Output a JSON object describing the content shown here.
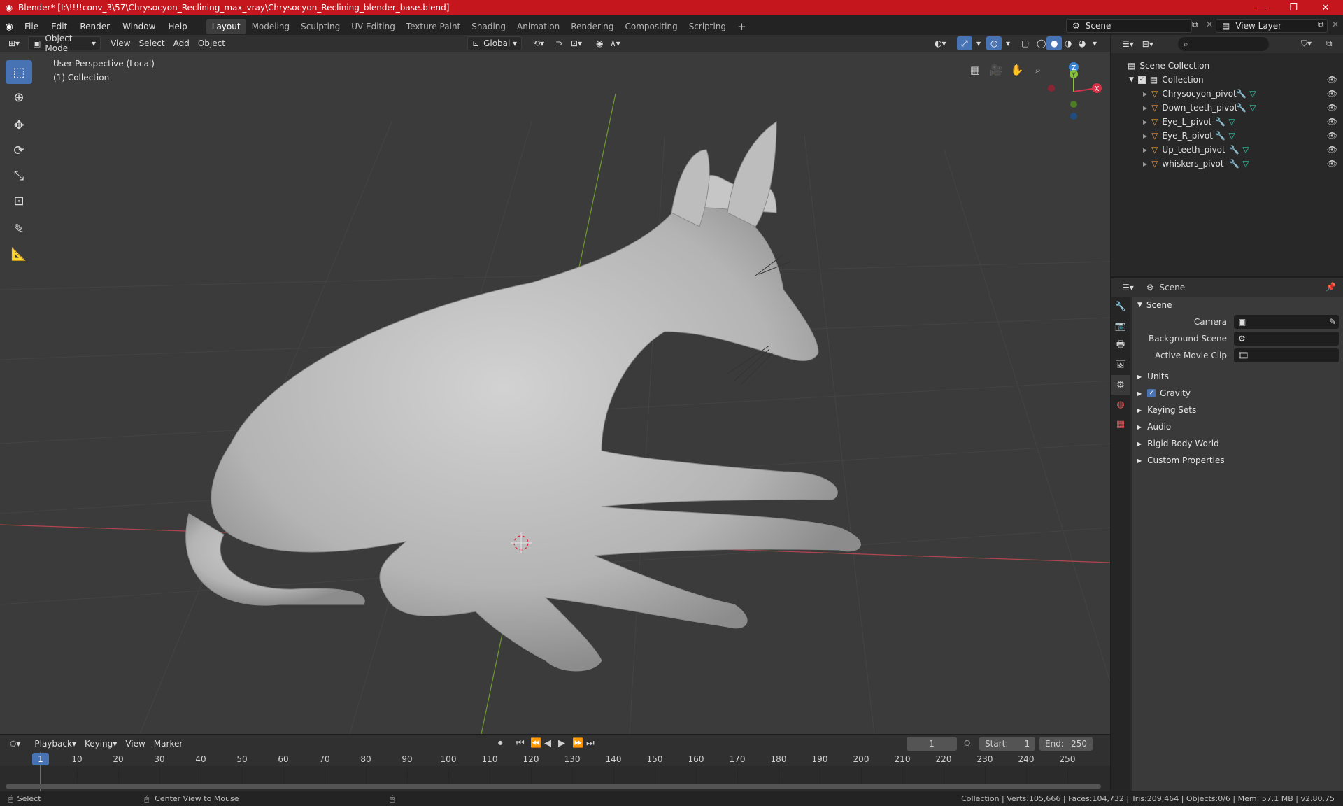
{
  "titlebar": {
    "title": "Blender* [I:\\!!!!conv_3\\57\\Chrysocyon_Reclining_max_vray\\Chrysocyon_Reclining_blender_base.blend]"
  },
  "menu": {
    "items": [
      "File",
      "Edit",
      "Render",
      "Window",
      "Help"
    ],
    "workspaces": [
      "Layout",
      "Modeling",
      "Sculpting",
      "UV Editing",
      "Texture Paint",
      "Shading",
      "Animation",
      "Rendering",
      "Compositing",
      "Scripting"
    ],
    "active_workspace": "Layout",
    "add_label": "+",
    "scene": "Scene",
    "view_layer": "View Layer"
  },
  "viewport": {
    "mode": "Object Mode",
    "menus": [
      "View",
      "Select",
      "Add",
      "Object"
    ],
    "transform_orientation": "Global",
    "overlay_line1": "User Perspective (Local)",
    "overlay_line2": "(1) Collection",
    "gizmo": {
      "x": "X",
      "y": "Y",
      "z": "Z"
    }
  },
  "outliner": {
    "root": "Scene Collection",
    "collection": "Collection",
    "objects": [
      "Chrysocyon_pivot",
      "Down_teeth_pivot",
      "Eye_L_pivot",
      "Eye_R_pivot",
      "Up_teeth_pivot",
      "whiskers_pivot"
    ]
  },
  "properties": {
    "header": "Scene",
    "panel": "Scene",
    "fields": [
      {
        "label": "Camera",
        "value": ""
      },
      {
        "label": "Background Scene",
        "value": ""
      },
      {
        "label": "Active Movie Clip",
        "value": ""
      }
    ],
    "sections": [
      "Units",
      "Gravity",
      "Keying Sets",
      "Audio",
      "Rigid Body World",
      "Custom Properties"
    ],
    "gravity_checked": true
  },
  "timeline": {
    "menus": [
      "Playback",
      "Keying",
      "View",
      "Marker"
    ],
    "current_frame": "1",
    "start_label": "Start:",
    "start": "1",
    "end_label": "End:",
    "end": "250",
    "frame_labels": [
      "1",
      "10",
      "20",
      "30",
      "40",
      "50",
      "60",
      "70",
      "80",
      "90",
      "100",
      "110",
      "120",
      "130",
      "140",
      "150",
      "160",
      "170",
      "180",
      "190",
      "200",
      "210",
      "220",
      "230",
      "240",
      "250"
    ]
  },
  "status": {
    "select": "Select",
    "center": "Center View to Mouse",
    "stats": "Collection | Verts:105,666 | Faces:104,732 | Tris:209,464 | Objects:0/6 | Mem: 57.1 MB | v2.80.75"
  },
  "colors": {
    "titlebar": "#c5161d",
    "accent": "#4772b3",
    "object_icon": "#e7973a",
    "mesh_icon": "#2ec7a6",
    "axis_x": "#d6334a",
    "axis_y": "#87c23b",
    "axis_z": "#3a84d6"
  }
}
